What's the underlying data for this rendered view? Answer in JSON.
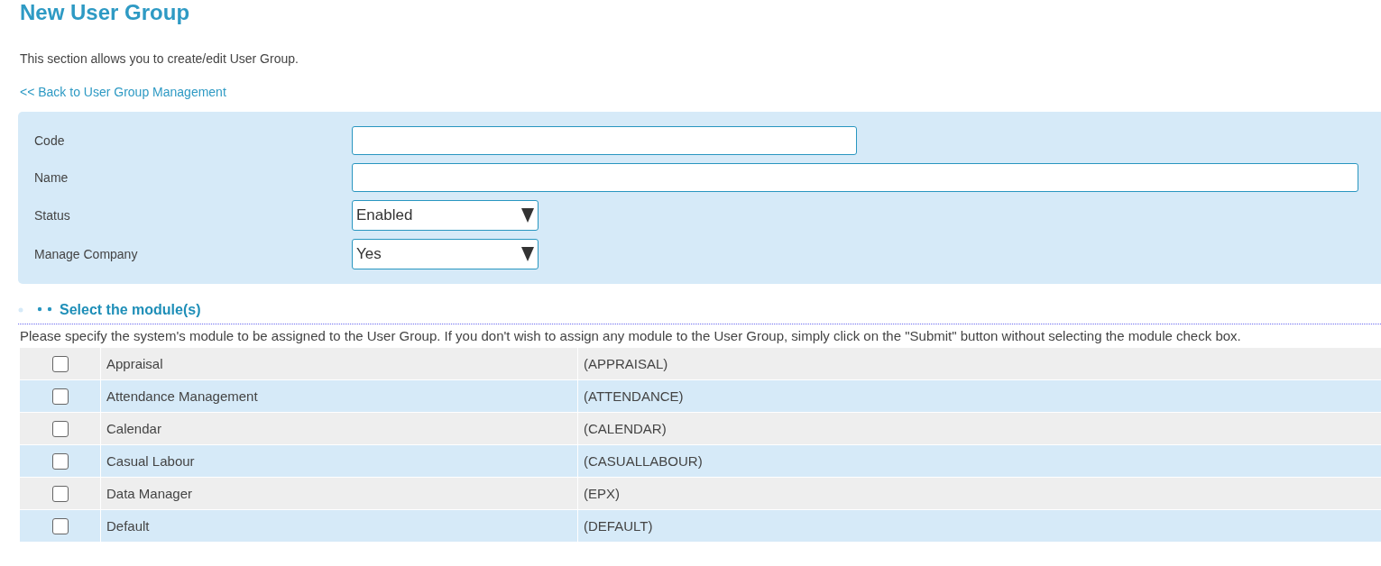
{
  "title": "New User Group",
  "description": "This section allows you to create/edit User Group.",
  "back_link": "<< Back to User Group Management",
  "form": {
    "fields": [
      {
        "kind": "short_text",
        "label": "Code"
      },
      {
        "kind": "long_text",
        "label": "Name"
      },
      {
        "kind": "select",
        "label": "Status",
        "value": "Enabled"
      },
      {
        "kind": "select",
        "label": "Manage Company",
        "value": "Yes"
      }
    ]
  },
  "modules": {
    "heading": "Select the module(s)",
    "instructions": "Please specify the system's module to be assigned to the User Group. If you don't wish to assign any module to the User Group, simply click on the \"Submit\" button without selecting the module check box.",
    "rows": [
      {
        "name": "Appraisal",
        "code": "(APPRAISAL)",
        "checked": false
      },
      {
        "name": "Attendance Management",
        "code": "(ATTENDANCE)",
        "checked": false
      },
      {
        "name": "Calendar",
        "code": "(CALENDAR)",
        "checked": false
      },
      {
        "name": "Casual Labour",
        "code": "(CASUALLABOUR)",
        "checked": false
      },
      {
        "name": "Data Manager",
        "code": "(EPX)",
        "checked": false
      },
      {
        "name": "Default",
        "code": "(DEFAULT)",
        "checked": false
      }
    ]
  }
}
